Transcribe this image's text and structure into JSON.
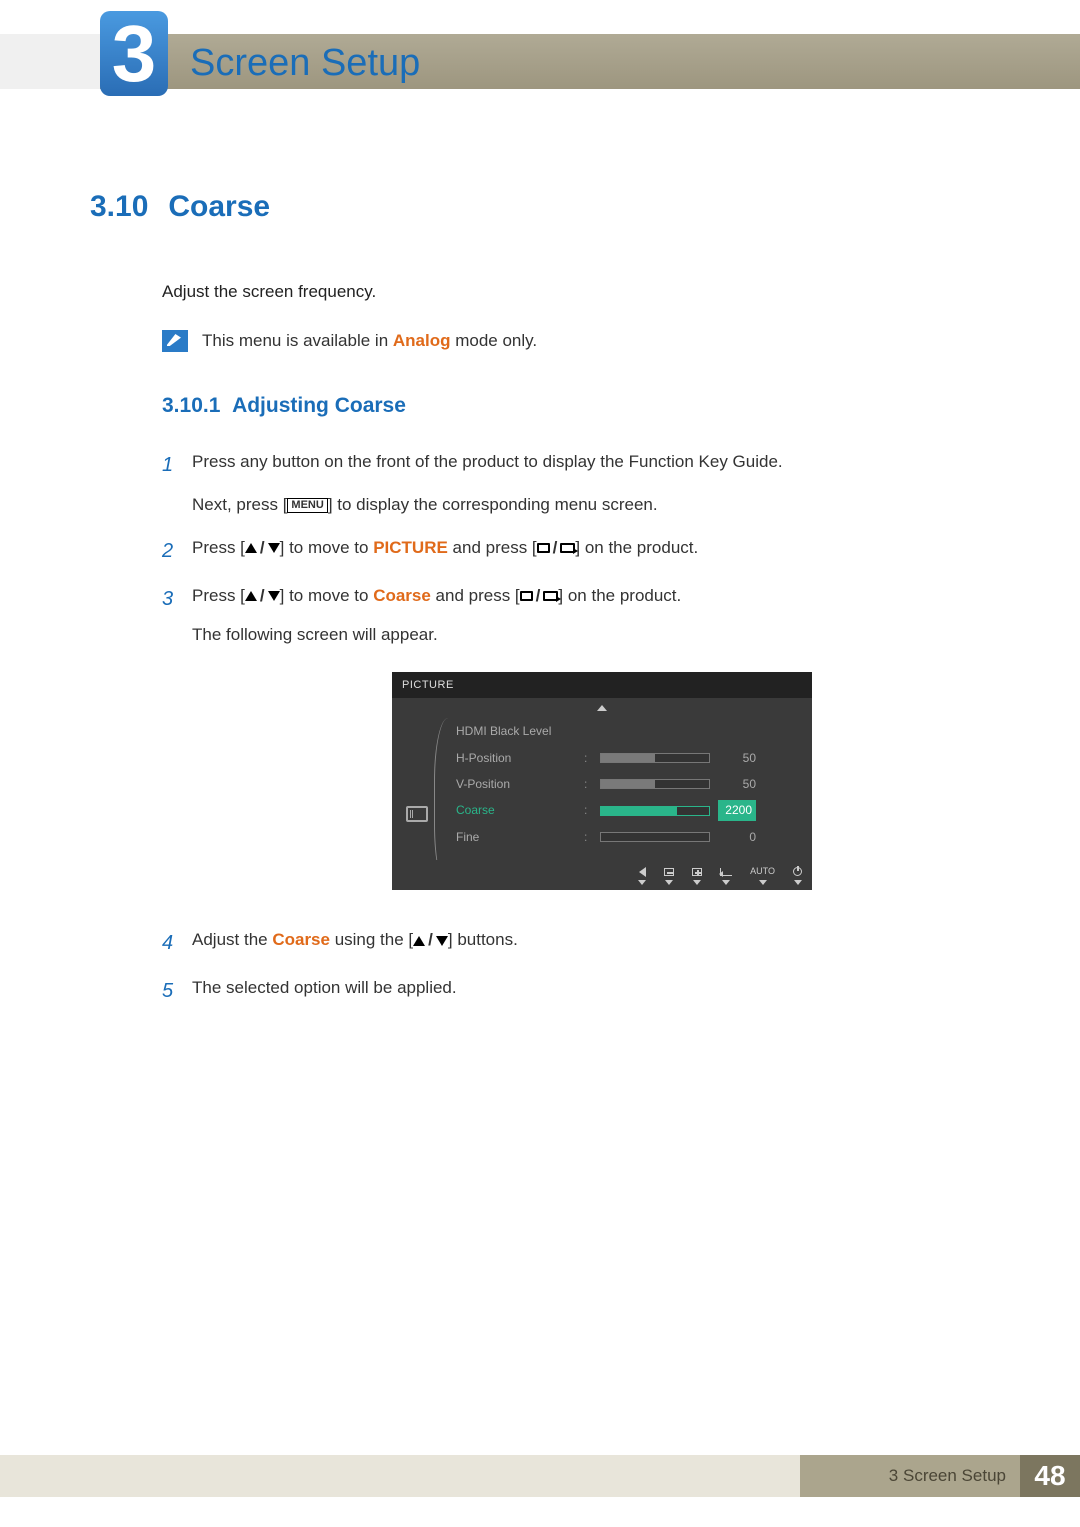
{
  "chapter": {
    "number": "3",
    "title": "Screen Setup"
  },
  "section": {
    "number": "3.10",
    "title": "Coarse"
  },
  "intro": "Adjust the screen frequency.",
  "note": {
    "prefix": "This menu is available in ",
    "highlight": "Analog",
    "suffix": " mode only."
  },
  "subsection": {
    "number": "3.10.1",
    "title": "Adjusting Coarse"
  },
  "steps": {
    "s1": {
      "num": "1",
      "line1": "Press any button on the front of the product to display the Function Key Guide.",
      "line2a": "Next, press [",
      "menu": "MENU",
      "line2b": "] to display the corresponding menu screen."
    },
    "s2": {
      "num": "2",
      "a": "Press [",
      "b": "] to move to ",
      "hl": "PICTURE",
      "c": " and press [",
      "d": "] on the product."
    },
    "s3": {
      "num": "3",
      "a": "Press [",
      "b": "] to move to ",
      "hl": "Coarse",
      "c": " and press [",
      "d": "] on the product.",
      "line2": "The following screen will appear."
    },
    "s4": {
      "num": "4",
      "a": "Adjust the ",
      "hl": "Coarse",
      "b": " using the [",
      "c": "] buttons."
    },
    "s5": {
      "num": "5",
      "text": "The selected option will be applied."
    }
  },
  "osd": {
    "title": "PICTURE",
    "rows": [
      {
        "label": "HDMI Black Level",
        "value": "",
        "pct": null
      },
      {
        "label": "H-Position",
        "value": "50",
        "pct": 50
      },
      {
        "label": "V-Position",
        "value": "50",
        "pct": 50
      },
      {
        "label": "Coarse",
        "value": "2200",
        "pct": 70,
        "active": true
      },
      {
        "label": "Fine",
        "value": "0",
        "pct": 0
      }
    ],
    "footer": {
      "auto": "AUTO"
    }
  },
  "footer": {
    "chapter_label": "3 Screen Setup",
    "page": "48"
  }
}
